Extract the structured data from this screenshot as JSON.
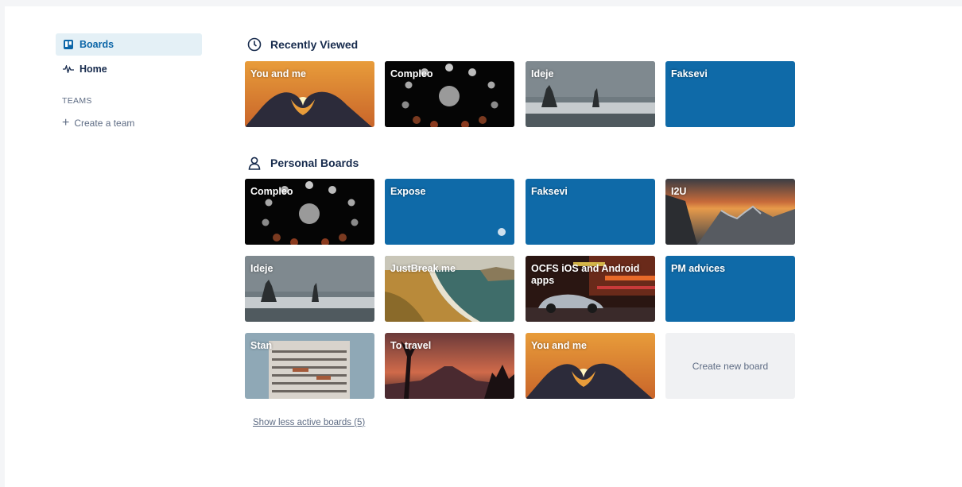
{
  "sidebar": {
    "items": [
      {
        "label": "Boards",
        "icon": "trello-board-icon",
        "active": true
      },
      {
        "label": "Home",
        "icon": "pulse-icon",
        "active": false
      }
    ],
    "teams_heading": "TEAMS",
    "create_team_label": "Create a team"
  },
  "recent": {
    "title": "Recently Viewed",
    "icon": "clock-icon",
    "boards": [
      {
        "title": "You and me",
        "bg": "hands-heart-sunset"
      },
      {
        "title": "Compleo",
        "bg": "moon-phases"
      },
      {
        "title": "Ideje",
        "bg": "sea-stacks-beach"
      },
      {
        "title": "Faksevi",
        "bg": "solid-blue"
      }
    ]
  },
  "personal": {
    "title": "Personal Boards",
    "icon": "person-icon",
    "boards": [
      {
        "title": "Compleo",
        "bg": "moon-phases"
      },
      {
        "title": "Expose",
        "bg": "solid-blue"
      },
      {
        "title": "Faksevi",
        "bg": "solid-blue"
      },
      {
        "title": "I2U",
        "bg": "mountain-sunset"
      },
      {
        "title": "Ideje",
        "bg": "sea-stacks-beach"
      },
      {
        "title": "JustBreak.me",
        "bg": "coastal-cliffs"
      },
      {
        "title": "OCFS iOS and Android apps",
        "bg": "car-city-lights"
      },
      {
        "title": "PM advices",
        "bg": "solid-blue"
      },
      {
        "title": "Stan",
        "bg": "apartment-building"
      },
      {
        "title": "To travel",
        "bg": "volcano-dusk"
      },
      {
        "title": "You and me",
        "bg": "hands-heart-sunset"
      }
    ],
    "create_label": "Create new board"
  },
  "show_less_label": "Show less active boards (5)",
  "colors": {
    "accent": "#0c66a8",
    "board_blue": "#0f6aa8",
    "active_bg": "#e4f0f6"
  }
}
